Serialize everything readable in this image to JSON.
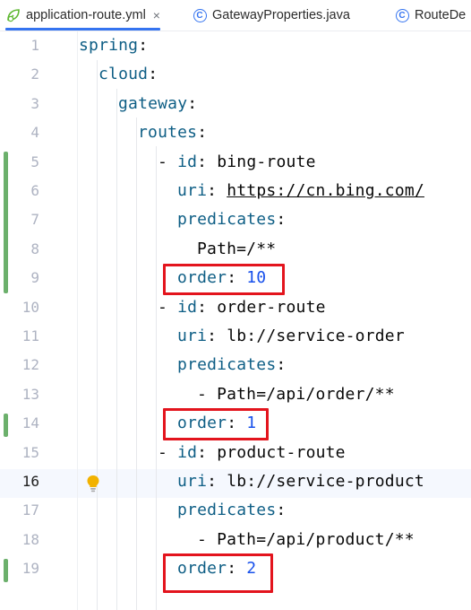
{
  "tabs": [
    {
      "label": "application-route.yml",
      "icon": "yaml-leaf-icon",
      "active": true,
      "close": "×"
    },
    {
      "label": "GatewayProperties.java",
      "icon": "class-icon",
      "active": false
    },
    {
      "label": "RouteDe",
      "icon": "class-icon",
      "active": false
    }
  ],
  "lines": [
    {
      "num": "1",
      "key": "spring",
      "sep": ":",
      "value": ""
    },
    {
      "num": "2",
      "key": "cloud",
      "sep": ":",
      "value": ""
    },
    {
      "num": "3",
      "key": "gateway",
      "sep": ":",
      "value": ""
    },
    {
      "num": "4",
      "key": "routes",
      "sep": ":",
      "value": ""
    },
    {
      "num": "5",
      "dash": "- ",
      "key": "id",
      "sep": ": ",
      "value": "bing-route"
    },
    {
      "num": "6",
      "key": "uri",
      "sep": ": ",
      "value": "https://cn.bing.com/"
    },
    {
      "num": "7",
      "key": "predicates",
      "sep": ":",
      "value": ""
    },
    {
      "num": "8",
      "plain": "Path=/**"
    },
    {
      "num": "9",
      "key": "order",
      "sep": ": ",
      "value": "10"
    },
    {
      "num": "10",
      "dash": "- ",
      "key": "id",
      "sep": ": ",
      "value": "order-route"
    },
    {
      "num": "11",
      "key": "uri",
      "sep": ": ",
      "value": "lb://service-order"
    },
    {
      "num": "12",
      "key": "predicates",
      "sep": ":",
      "value": ""
    },
    {
      "num": "13",
      "plain": "- Path=/api/order/**"
    },
    {
      "num": "14",
      "key": "order",
      "sep": ": ",
      "value": "1"
    },
    {
      "num": "15",
      "dash": "- ",
      "key": "id",
      "sep": ": ",
      "value": "product-route"
    },
    {
      "num": "16",
      "key": "uri",
      "sep": ": ",
      "value": "lb://service-product"
    },
    {
      "num": "17",
      "key": "predicates",
      "sep": ":",
      "value": ""
    },
    {
      "num": "18",
      "plain": "- Path=/api/product/**"
    },
    {
      "num": "19",
      "key": "order",
      "sep": ": ",
      "value": "2"
    }
  ],
  "current_line": "16",
  "colors": {
    "key": "#0e5e85",
    "number": "#1750eb",
    "highlight_box": "#e3141d",
    "change_marker": "#6cb06c",
    "tab_underline": "#3574f0"
  }
}
